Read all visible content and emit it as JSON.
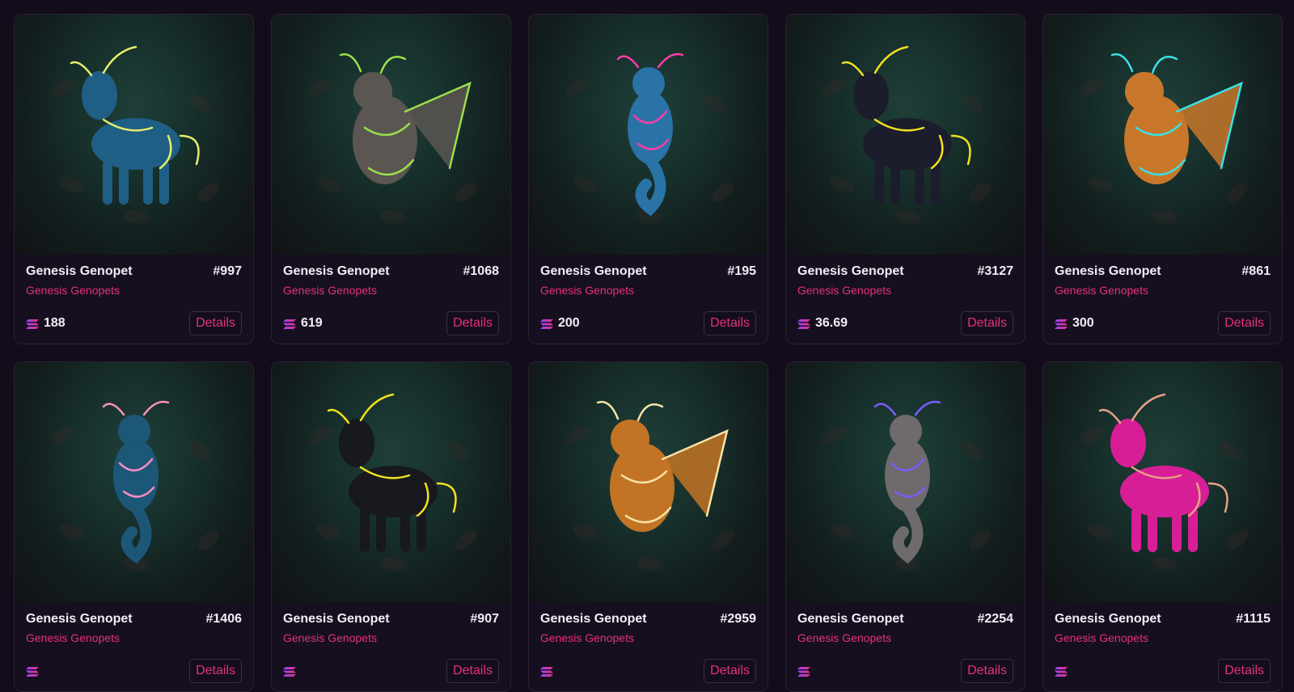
{
  "cards": [
    {
      "name": "Genesis Genopet",
      "number": "#997",
      "collection": "Genesis Genopets",
      "price": "188",
      "details_label": "Details",
      "glow": "#e8ee6a",
      "body": "#1f5f86"
    },
    {
      "name": "Genesis Genopet",
      "number": "#1068",
      "collection": "Genesis Genopets",
      "price": "619",
      "details_label": "Details",
      "glow": "#9be04a",
      "body": "#5b5652"
    },
    {
      "name": "Genesis Genopet",
      "number": "#195",
      "collection": "Genesis Genopets",
      "price": "200",
      "details_label": "Details",
      "glow": "#ff3da8",
      "body": "#2a73a6"
    },
    {
      "name": "Genesis Genopet",
      "number": "#3127",
      "collection": "Genesis Genopets",
      "price": "36.69",
      "details_label": "Details",
      "glow": "#f2e21c",
      "body": "#1b1d2c"
    },
    {
      "name": "Genesis Genopet",
      "number": "#861",
      "collection": "Genesis Genopets",
      "price": "300",
      "details_label": "Details",
      "glow": "#3be0e6",
      "body": "#c8772a"
    },
    {
      "name": "Genesis Genopet",
      "number": "#1406",
      "collection": "Genesis Genopets",
      "price": "",
      "details_label": "Details",
      "glow": "#ff8fc0",
      "body": "#1c5778"
    },
    {
      "name": "Genesis Genopet",
      "number": "#907",
      "collection": "Genesis Genopets",
      "price": "",
      "details_label": "Details",
      "glow": "#f5e21a",
      "body": "#18181f"
    },
    {
      "name": "Genesis Genopet",
      "number": "#2959",
      "collection": "Genesis Genopets",
      "price": "",
      "details_label": "Details",
      "glow": "#f7e4a8",
      "body": "#c27424"
    },
    {
      "name": "Genesis Genopet",
      "number": "#2254",
      "collection": "Genesis Genopets",
      "price": "",
      "details_label": "Details",
      "glow": "#7a5cff",
      "body": "#6f6a6c"
    },
    {
      "name": "Genesis Genopet",
      "number": "#1115",
      "collection": "Genesis Genopets",
      "price": "",
      "details_label": "Details",
      "glow": "#e8a08a",
      "body": "#d81e97"
    }
  ],
  "icons": {
    "price": "solana-icon"
  },
  "colors": {
    "accent": "#e5307f",
    "background": "#130d1b",
    "card": "#160f1f"
  }
}
